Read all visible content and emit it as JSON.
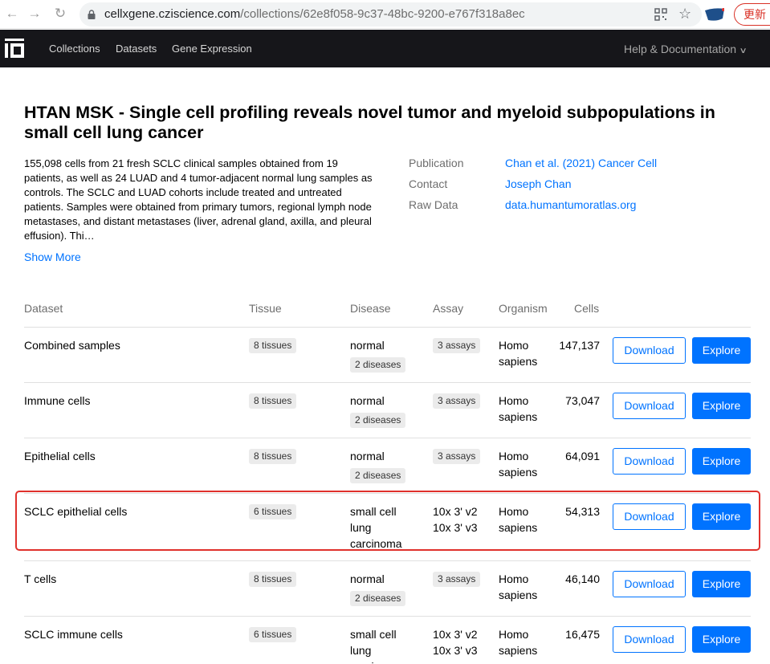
{
  "browser": {
    "url_host": "cellxgene.cziscience.com",
    "url_path": "/collections/62e8f058-9c37-48bc-9200-e767f318a8ec",
    "update_label": "更新"
  },
  "header": {
    "nav": [
      "Collections",
      "Datasets",
      "Gene Expression"
    ],
    "help_label": "Help & Documentation"
  },
  "collection": {
    "title": "HTAN MSK - Single cell profiling reveals novel tumor and myeloid subpopulations in small cell lung cancer",
    "description": "155,098 cells from 21 fresh SCLC clinical samples obtained from 19 patients, as well as 24 LUAD and 4 tumor-adjacent normal lung samples as controls. The SCLC and LUAD cohorts include treated and untreated patients. Samples were obtained from primary tumors, regional lymph node metastases, and distant metastases (liver, adrenal gland, axilla, and pleural effusion). Thi…",
    "show_more": "Show More",
    "meta": [
      {
        "label": "Publication",
        "value": "Chan et al. (2021) Cancer Cell"
      },
      {
        "label": "Contact",
        "value": "Joseph Chan"
      },
      {
        "label": "Raw Data",
        "value": "data.humantumoratlas.org"
      }
    ]
  },
  "table": {
    "headers": [
      "Dataset",
      "Tissue",
      "Disease",
      "Assay",
      "Organism",
      "Cells"
    ],
    "download_label": "Download",
    "explore_label": "Explore",
    "rows": [
      {
        "name": "Combined samples",
        "tissue": "8 tissues",
        "disease": "normal",
        "disease_tag": "2 diseases",
        "assay_tag": "3 assays",
        "organism": "Homo sapiens",
        "cells": "147,137"
      },
      {
        "name": "Immune cells",
        "tissue": "8 tissues",
        "disease": "normal",
        "disease_tag": "2 diseases",
        "assay_tag": "3 assays",
        "organism": "Homo sapiens",
        "cells": "73,047"
      },
      {
        "name": "Epithelial cells",
        "tissue": "8 tissues",
        "disease": "normal",
        "disease_tag": "2 diseases",
        "assay_tag": "3 assays",
        "organism": "Homo sapiens",
        "cells": "64,091"
      },
      {
        "name": "SCLC epithelial cells",
        "tissue": "6 tissues",
        "disease": "small cell lung carcinoma",
        "assay_1": "10x 3' v2",
        "assay_2": "10x 3' v3",
        "organism": "Homo sapiens",
        "cells": "54,313"
      },
      {
        "name": "T cells",
        "tissue": "8 tissues",
        "disease": "normal",
        "disease_tag": "2 diseases",
        "assay_tag": "3 assays",
        "organism": "Homo sapiens",
        "cells": "46,140"
      },
      {
        "name": "SCLC immune cells",
        "tissue": "6 tissues",
        "disease": "small cell lung carcinoma",
        "assay_1": "10x 3' v2",
        "assay_2": "10x 3' v3",
        "organism": "Homo sapiens",
        "cells": "16,475"
      }
    ]
  },
  "colors": {
    "accent": "#0073ff",
    "header_bg": "#16161a",
    "highlight": "#e0312c"
  }
}
